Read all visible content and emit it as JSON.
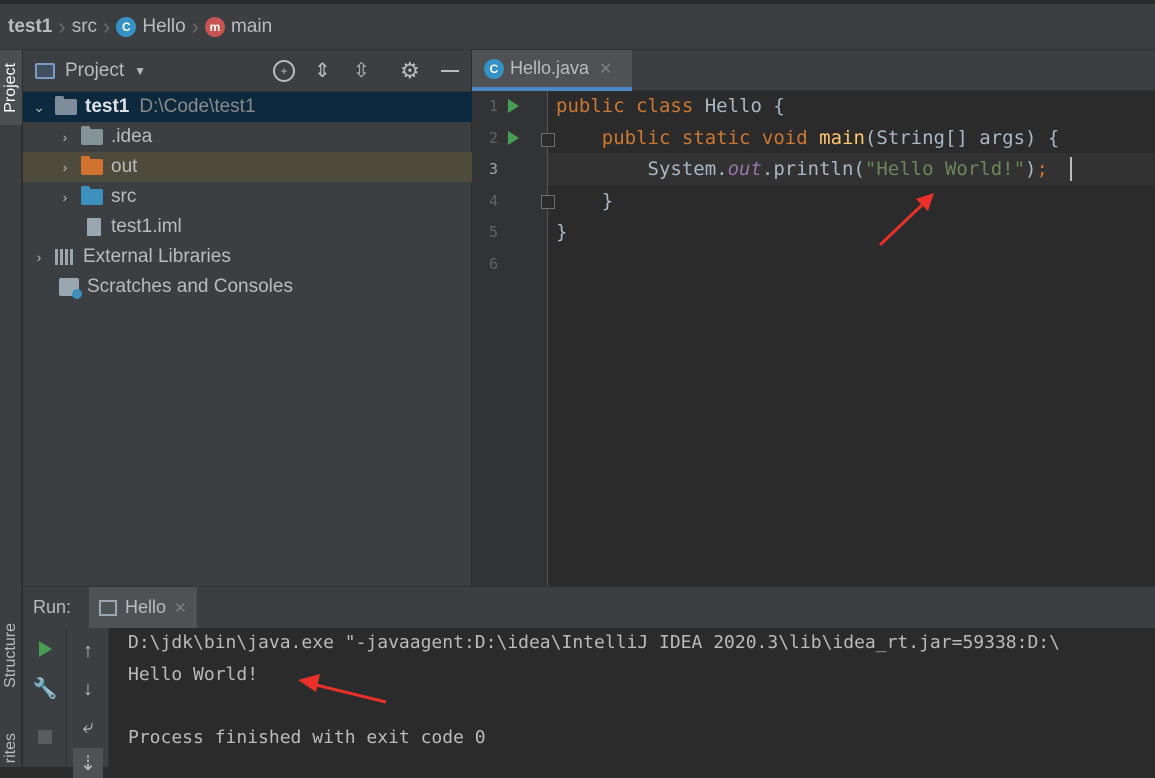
{
  "navbar": {
    "project": "test1",
    "folder": "src",
    "class_name": "Hello",
    "method_name": "main",
    "class_icon_letter": "C",
    "method_icon_letter": "m"
  },
  "left_stripe": {
    "project_tab": "Project",
    "structure_tab": "Structure",
    "favorites_tab": "rites"
  },
  "project_panel": {
    "title": "Project",
    "tree": [
      {
        "label": "test1",
        "path": "D:\\Code\\test1",
        "icon": "module-folder-icon"
      },
      {
        "label": ".idea",
        "icon": "folder-icon"
      },
      {
        "label": "out",
        "icon": "excluded-folder-icon"
      },
      {
        "label": "src",
        "icon": "source-folder-icon"
      },
      {
        "label": "test1.iml",
        "icon": "iml-file-icon"
      },
      {
        "label": "External Libraries",
        "icon": "libraries-icon"
      },
      {
        "label": "Scratches and Consoles",
        "icon": "scratches-icon"
      }
    ]
  },
  "editor": {
    "tab_label": "Hello.java",
    "line_numbers": [
      "1",
      "2",
      "3",
      "4",
      "5",
      "6"
    ],
    "code": {
      "l1_kw": "public class",
      "l1_rest": " Hello {",
      "l2_kw": "public static void",
      "l2_fn": "main",
      "l2_rest": "(String[] args) {",
      "l3_a": "System.",
      "l3_field": "out",
      "l3_b": ".println(",
      "l3_str": "\"Hello World!\"",
      "l3_c": ")",
      "l3_semi": ";",
      "l4": "}",
      "l5": "}"
    }
  },
  "run_panel": {
    "label": "Run:",
    "tab_label": "Hello",
    "console_lines": [
      "D:\\jdk\\bin\\java.exe \"-javaagent:D:\\idea\\IntelliJ IDEA 2020.3\\lib\\idea_rt.jar=59338:D:\\",
      "Hello World!",
      "",
      "Process finished with exit code 0"
    ]
  },
  "colors": {
    "keyword": "#cc7832",
    "method": "#ffc66d",
    "string": "#6a8759",
    "static_field": "#9876aa",
    "annotation_arrow": "#e8312a"
  }
}
